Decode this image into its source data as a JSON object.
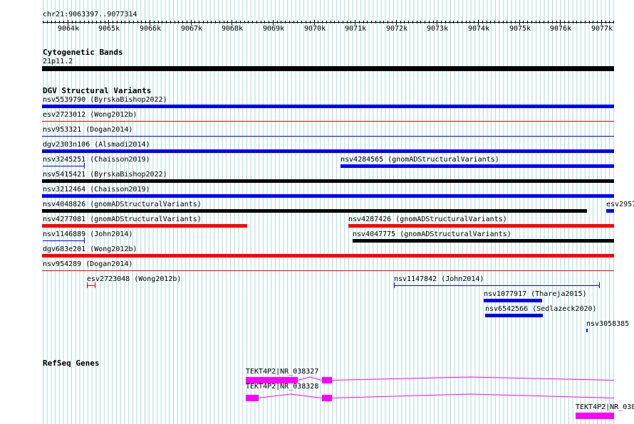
{
  "locus": "chr21:9063397..9077314",
  "ruler": {
    "ticks": [
      "9064k",
      "9065k",
      "9066k",
      "9067k",
      "9068k",
      "9069k",
      "9070k",
      "9071k",
      "9072k",
      "9073k",
      "9074k",
      "9075k",
      "9076k",
      "9077k"
    ]
  },
  "cytoband": {
    "title": "Cytogenetic Bands",
    "band": "21p11.2"
  },
  "dgv": {
    "title": "DGV Structural Variants",
    "features": [
      {
        "label": "nsv5539790 (ByrskaBishop2022)"
      },
      {
        "label": "esv2723012 (Wong2012b)"
      },
      {
        "label": "nsv953321 (Dogan2014)"
      },
      {
        "label": "dgv2303n106 (Alsmadi2014)"
      },
      {
        "label": "nsv3245251 (Chaisson2019)"
      },
      {
        "label": "nsv4284565 (gnomADStructuralVariants)"
      },
      {
        "label": "nsv5415421 (ByrskaBishop2022)"
      },
      {
        "label": "nsv3212464 (Chaisson2019)"
      },
      {
        "label": "nsv4048826 (gnomADStructuralVariants)"
      },
      {
        "label": "esv2957"
      },
      {
        "label": "nsv4277081 (gnomADStructuralVariants)"
      },
      {
        "label": "nsv4287426 (gnomADStructuralVariants)"
      },
      {
        "label": "nsv1146889 (John2014)"
      },
      {
        "label": "nsv4047775 (gnomADStructuralVariants)"
      },
      {
        "label": "dgv683e201 (Wong2012b)"
      },
      {
        "label": "nsv954289 (Dogan2014)"
      },
      {
        "label": "esv2723048 (Wong2012b)"
      },
      {
        "label": "nsv1147842 (John2014)"
      },
      {
        "label": "nsv1077917 (Thareja2015)"
      },
      {
        "label": "nsv6542566 (Sedlazeck2020)"
      },
      {
        "label": "nsv3058385"
      }
    ]
  },
  "refseq": {
    "title": "RefSeq Genes",
    "genes": [
      {
        "label": "TEKT4P2|NR_038327"
      },
      {
        "label": "TEKT4P2|NR_038328"
      },
      {
        "label": "TEKT4P2|NR_038"
      }
    ]
  },
  "colors": {
    "gridline": "#a8dcdc",
    "cytoband": "#000000",
    "gain": "#0000ff",
    "loss": "#ff0000",
    "complex": "#000000",
    "gene": "#ff00ff"
  }
}
